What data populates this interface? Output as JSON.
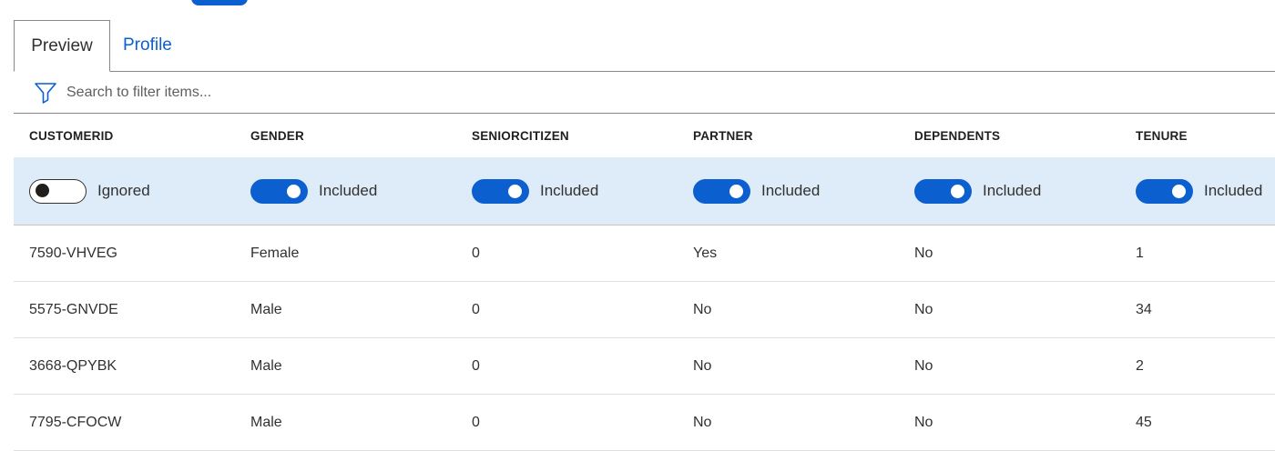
{
  "tabs": {
    "preview": "Preview",
    "profile": "Profile"
  },
  "search": {
    "placeholder": "Search to filter items..."
  },
  "columns": [
    "CUSTOMERID",
    "GENDER",
    "SENIORCITIZEN",
    "PARTNER",
    "DEPENDENTS",
    "TENURE"
  ],
  "column_toggles": [
    {
      "state": "off",
      "label": "Ignored"
    },
    {
      "state": "on",
      "label": "Included"
    },
    {
      "state": "on",
      "label": "Included"
    },
    {
      "state": "on",
      "label": "Included"
    },
    {
      "state": "on",
      "label": "Included"
    },
    {
      "state": "on",
      "label": "Included"
    }
  ],
  "rows": [
    [
      "7590-VHVEG",
      "Female",
      "0",
      "Yes",
      "No",
      "1"
    ],
    [
      "5575-GNVDE",
      "Male",
      "0",
      "No",
      "No",
      "34"
    ],
    [
      "3668-QPYBK",
      "Male",
      "0",
      "No",
      "No",
      "2"
    ],
    [
      "7795-CFOCW",
      "Male",
      "0",
      "No",
      "No",
      "45"
    ]
  ],
  "colors": {
    "accent": "#0b5fcf",
    "toggle_row_bg": "#deecf9"
  },
  "icons": {
    "filter": "filter-icon"
  }
}
